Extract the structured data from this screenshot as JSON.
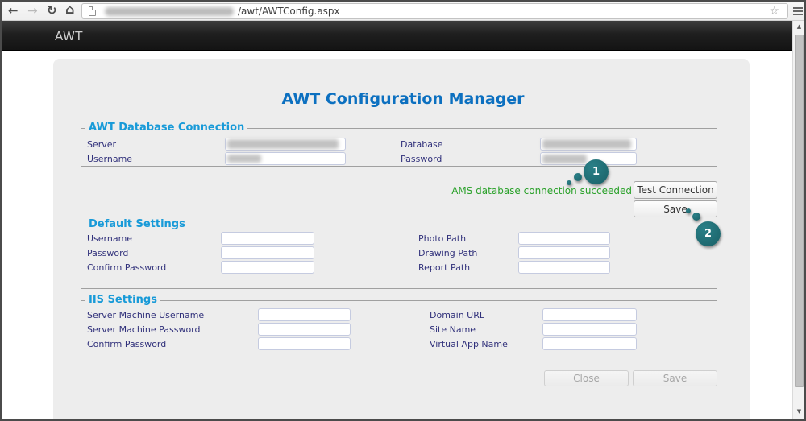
{
  "browser": {
    "url_visible": "/awt/AWTConfig.aspx",
    "back_icon": "←",
    "forward_icon": "→",
    "refresh_icon": "↻",
    "home_icon": "⌂",
    "star_icon": "☆",
    "scroll_up": "▲",
    "scroll_down": "▼"
  },
  "navbar": {
    "brand": "AWT"
  },
  "page": {
    "title": "AWT Configuration Manager"
  },
  "db": {
    "legend": "AWT Database Connection",
    "rows": [
      {
        "label": "Server"
      },
      {
        "label": "Database"
      },
      {
        "label": "Username"
      },
      {
        "label": "Password"
      }
    ]
  },
  "status": {
    "message": "AMS database connection succeeded",
    "test_button": "Test Connection",
    "save_button": "Save"
  },
  "defaults": {
    "legend": "Default Settings",
    "left": [
      "Username",
      "Password",
      "Confirm Password"
    ],
    "right": [
      "Photo Path",
      "Drawing Path",
      "Report Path"
    ]
  },
  "iis": {
    "legend": "IIS Settings",
    "left": [
      "Server Machine Username",
      "Server Machine Password",
      "Confirm Password"
    ],
    "right": [
      "Domain URL",
      "Site Name",
      "Virtual App Name"
    ]
  },
  "footer": {
    "close_button": "Close",
    "save_button": "Save"
  },
  "callouts": [
    {
      "number": "1"
    },
    {
      "number": "2"
    }
  ],
  "colors": {
    "title_blue": "#0c70c0",
    "legend_blue": "#189ad8",
    "label_navy": "#31317b",
    "status_green": "#2aa12a",
    "badge_teal": "#1c6b70"
  }
}
